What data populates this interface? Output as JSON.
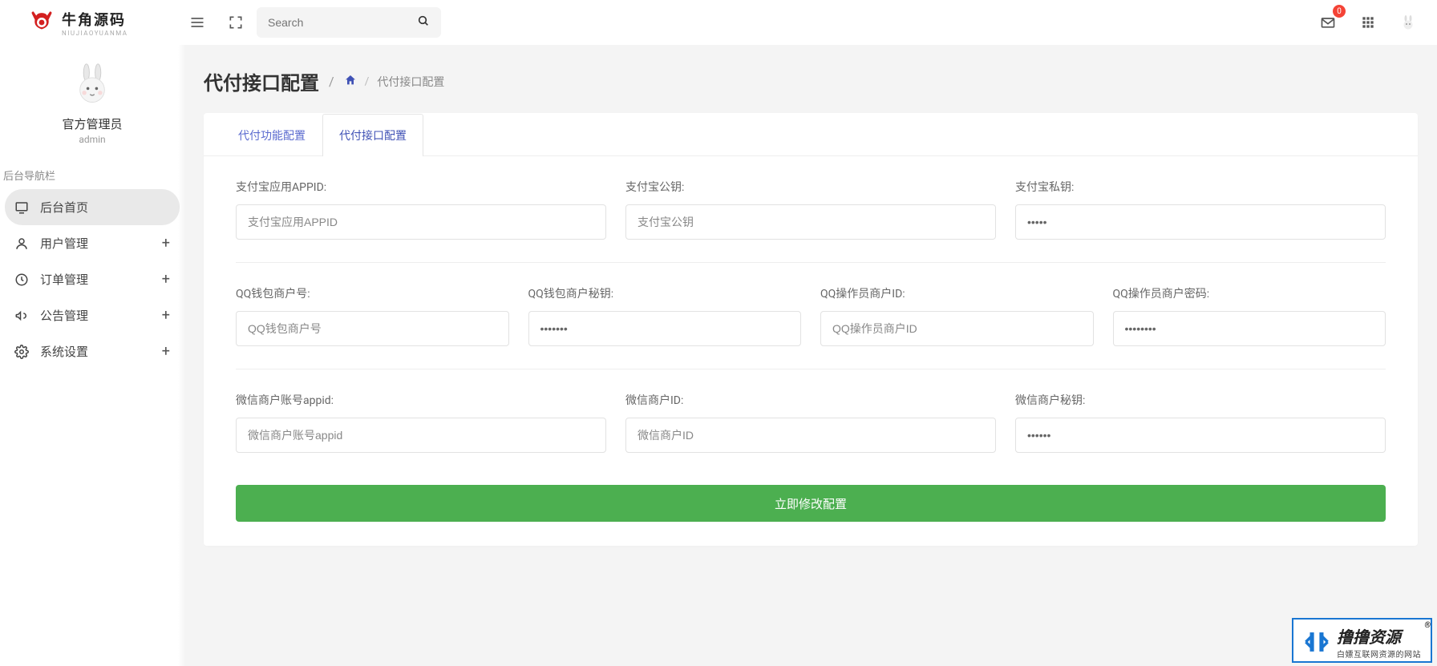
{
  "brand": {
    "cn": "牛角源码",
    "en": "NIUJIAOYUANMA"
  },
  "search": {
    "placeholder": "Search"
  },
  "notifications": {
    "count": "0"
  },
  "user": {
    "name": "官方管理员",
    "role": "admin"
  },
  "sidebar": {
    "section_label": "后台导航栏",
    "items": [
      {
        "label": "后台首页"
      },
      {
        "label": "用户管理"
      },
      {
        "label": "订单管理"
      },
      {
        "label": "公告管理"
      },
      {
        "label": "系统设置"
      }
    ]
  },
  "page": {
    "title": "代付接口配置",
    "breadcrumb_slash": "/",
    "breadcrumb_current": "代付接口配置"
  },
  "tabs": [
    {
      "label": "代付功能配置"
    },
    {
      "label": "代付接口配置"
    }
  ],
  "form": {
    "row1": {
      "alipay_appid": {
        "label": "支付宝应用APPID:",
        "placeholder": "支付宝应用APPID"
      },
      "alipay_pubkey": {
        "label": "支付宝公钥:",
        "placeholder": "支付宝公钥"
      },
      "alipay_privkey": {
        "label": "支付宝私钥:",
        "value": "•••••"
      }
    },
    "row2": {
      "qq_mch": {
        "label": "QQ钱包商户号:",
        "placeholder": "QQ钱包商户号"
      },
      "qq_mch_key": {
        "label": "QQ钱包商户秘钥:",
        "value": "•••••••"
      },
      "qq_op_id": {
        "label": "QQ操作员商户ID:",
        "placeholder": "QQ操作员商户ID"
      },
      "qq_op_pwd": {
        "label": "QQ操作员商户密码:",
        "value": "••••••••"
      }
    },
    "row3": {
      "wx_appid": {
        "label": "微信商户账号appid:",
        "placeholder": "微信商户账号appid"
      },
      "wx_mch_id": {
        "label": "微信商户ID:",
        "placeholder": "微信商户ID"
      },
      "wx_mch_key": {
        "label": "微信商户秘钥:",
        "value": "••••••"
      }
    },
    "submit": "立即修改配置"
  },
  "watermark": {
    "main": "撸撸资源",
    "sub": "白嫖互联网资源的网站"
  }
}
